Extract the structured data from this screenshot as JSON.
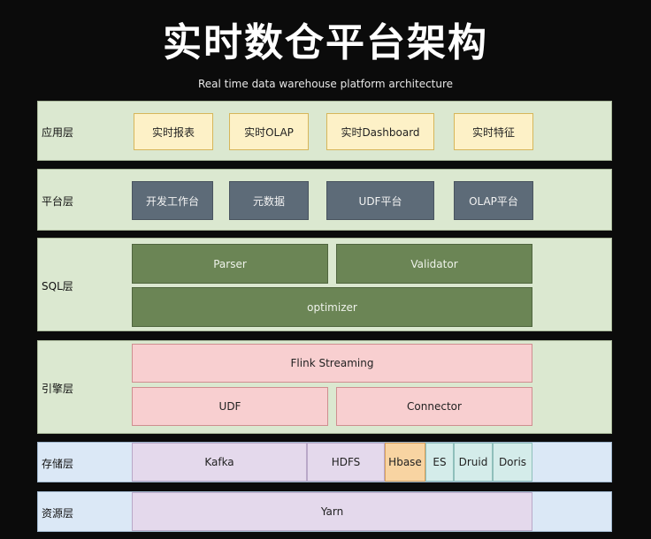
{
  "title": "实时数仓平台架构",
  "subtitle": "Real time data warehouse platform architecture",
  "colors": {
    "background": "#0b0b0b",
    "light_green": "#dbe8d0",
    "light_blue": "#dbe8f6",
    "app_box": "#fdf1c7",
    "platform_box": "#5d6b78",
    "sql_box": "#6b8555",
    "engine_box": "#f8cfd0",
    "storage_purple": "#e4d9ec",
    "hbase_orange": "#f8d4a2",
    "teal": "#d4ecea"
  },
  "layers": {
    "application": {
      "label": "应用层",
      "items": [
        "实时报表",
        "实时OLAP",
        "实时Dashboard",
        "实时特征"
      ]
    },
    "platform": {
      "label": "平台层",
      "items": [
        "开发工作台",
        "元数据",
        "UDF平台",
        "OLAP平台"
      ]
    },
    "sql": {
      "label": "SQL层",
      "parser": "Parser",
      "validator": "Validator",
      "optimizer": "optimizer"
    },
    "engine": {
      "label": "引擎层",
      "flink": "Flink Streaming",
      "udf": "UDF",
      "connector": "Connector"
    },
    "storage": {
      "label": "存储层",
      "items": [
        "Kafka",
        "HDFS",
        "Hbase",
        "ES",
        "Druid",
        "Doris"
      ]
    },
    "resource": {
      "label": "资源层",
      "yarn": "Yarn"
    }
  }
}
